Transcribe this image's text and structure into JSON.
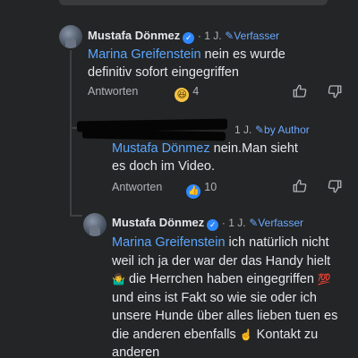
{
  "comments": [
    {
      "author": "Mustafa Dönmez",
      "time": "1 J.",
      "badge": "Verfasser",
      "mention": "Marina Greifenstein",
      "text": " nein es wurde definitiv sofort eingegriffen",
      "reply_label": "Antworten",
      "reaction_emoji": "😆",
      "reaction_count": "4"
    },
    {
      "time": "1 J.",
      "badge": "by Author",
      "mention": "Mustafa Dönmez",
      "text": " nein.Man sieht es doch im Video.",
      "reply_label": "Antworten",
      "reaction_emoji": "👍",
      "reaction_count": "10"
    },
    {
      "author": "Mustafa Dönmez",
      "time": "1 J.",
      "badge": "Verfasser",
      "mention": "Marina Greifenstein",
      "text_1": " ich natürlich nicht weil ich ja der war der das Handy hielt ",
      "emoji_1": "🤷‍♂️",
      "text_2": " die Herrchen haben eingegriffen ",
      "emoji_2": "💯",
      "text_3": " und eins ist Fakt so wie sie oder ich unsere Hunde über alles lieben tuen es die anderen ebenfalls ",
      "emoji_3": "☝️",
      "text_4": " Kontakt zu anderen"
    }
  ],
  "icons": {
    "verified": "✓",
    "pencil": "✎",
    "like": "thumbs-up-icon",
    "dislike": "thumbs-down-icon"
  }
}
